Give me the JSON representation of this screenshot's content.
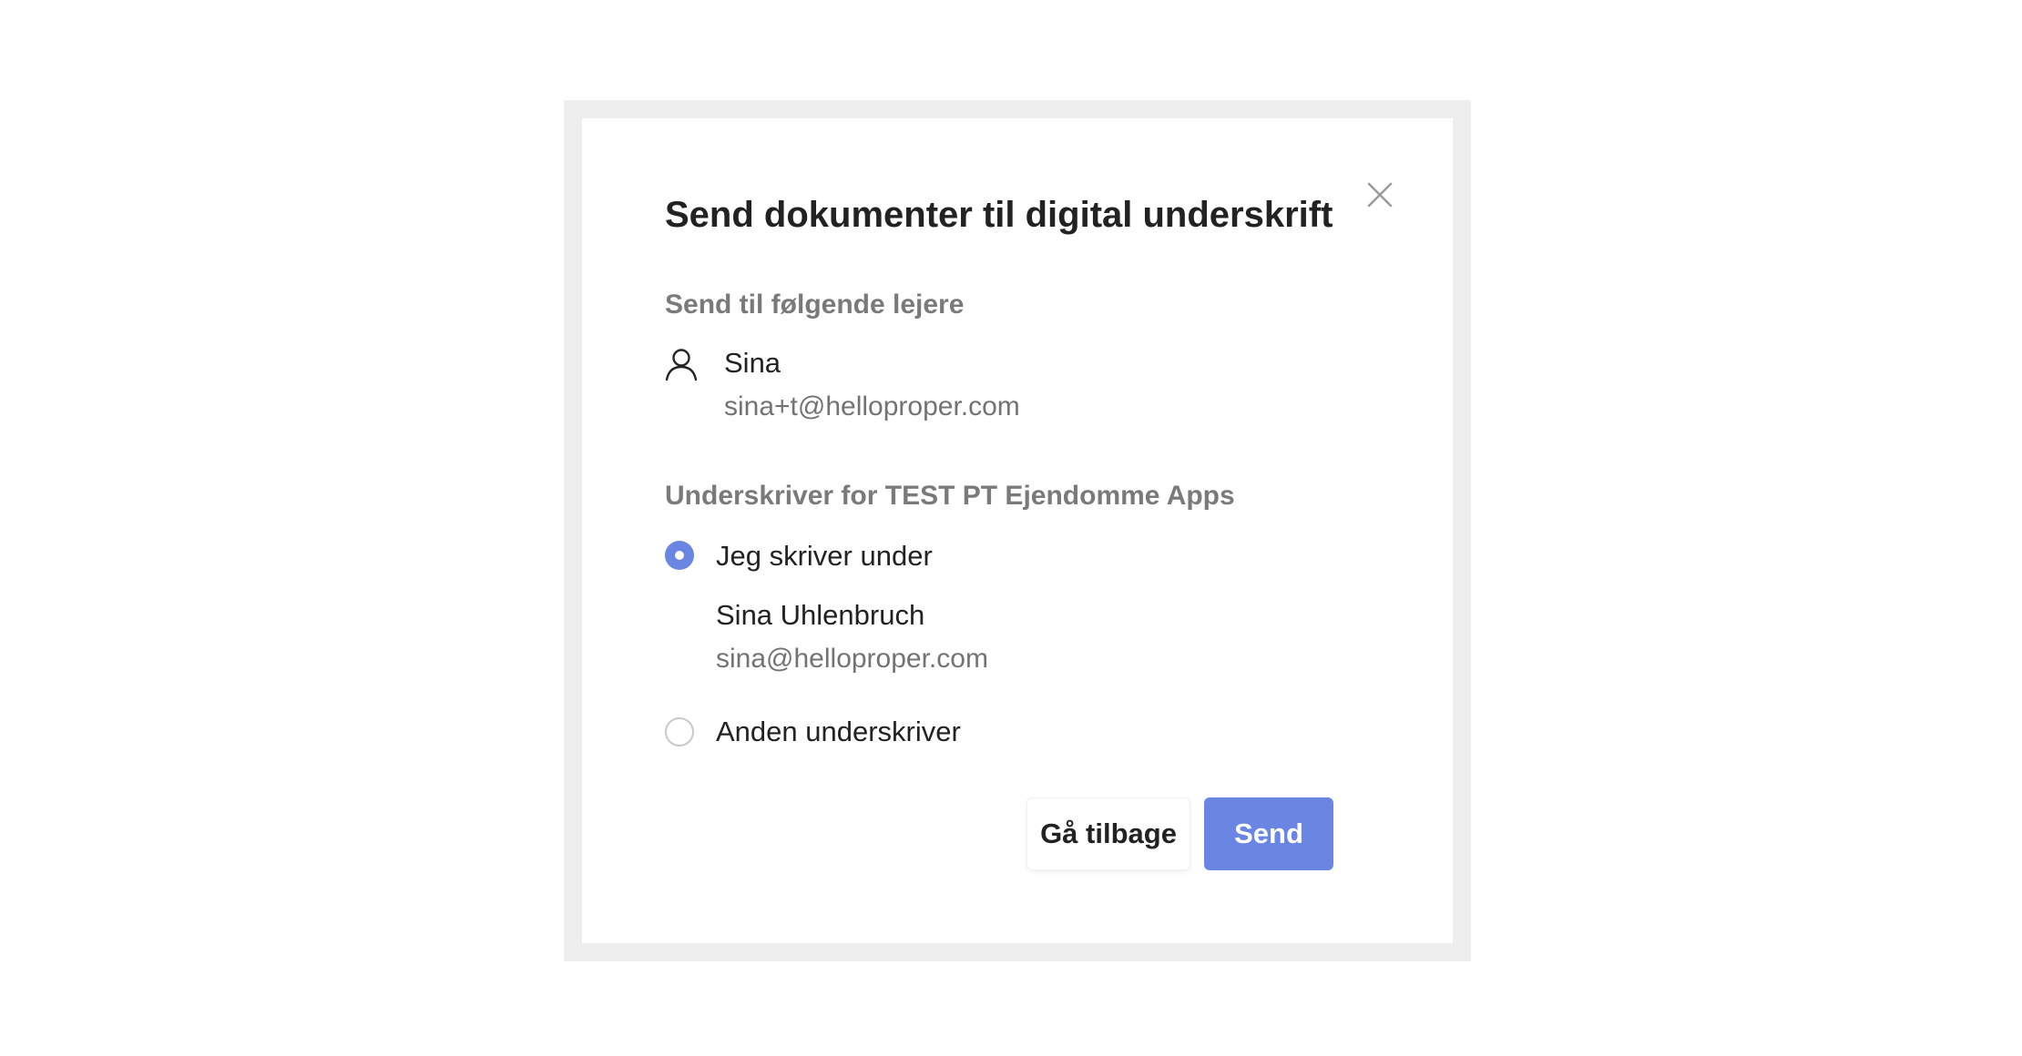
{
  "dialog": {
    "title": "Send dokumenter til digital underskrift",
    "close_icon": "close-icon"
  },
  "tenants": {
    "label": "Send til følgende lejere",
    "icon": "person-icon",
    "items": [
      {
        "name": "Sina",
        "email": "sina+t@helloproper.com"
      }
    ]
  },
  "signer": {
    "label": "Underskriver for TEST PT Ejendomme Apps",
    "options": [
      {
        "label": "Jeg skriver under",
        "selected": true,
        "name": "Sina Uhlenbruch",
        "email": "sina@helloproper.com"
      },
      {
        "label": "Anden underskriver",
        "selected": false
      }
    ]
  },
  "actions": {
    "back_label": "Gå tilbage",
    "send_label": "Send"
  },
  "colors": {
    "accent": "#6b86e2",
    "overlay_frame": "#eeeeee",
    "muted_text": "#737373",
    "section_label": "#7a7a7a"
  }
}
